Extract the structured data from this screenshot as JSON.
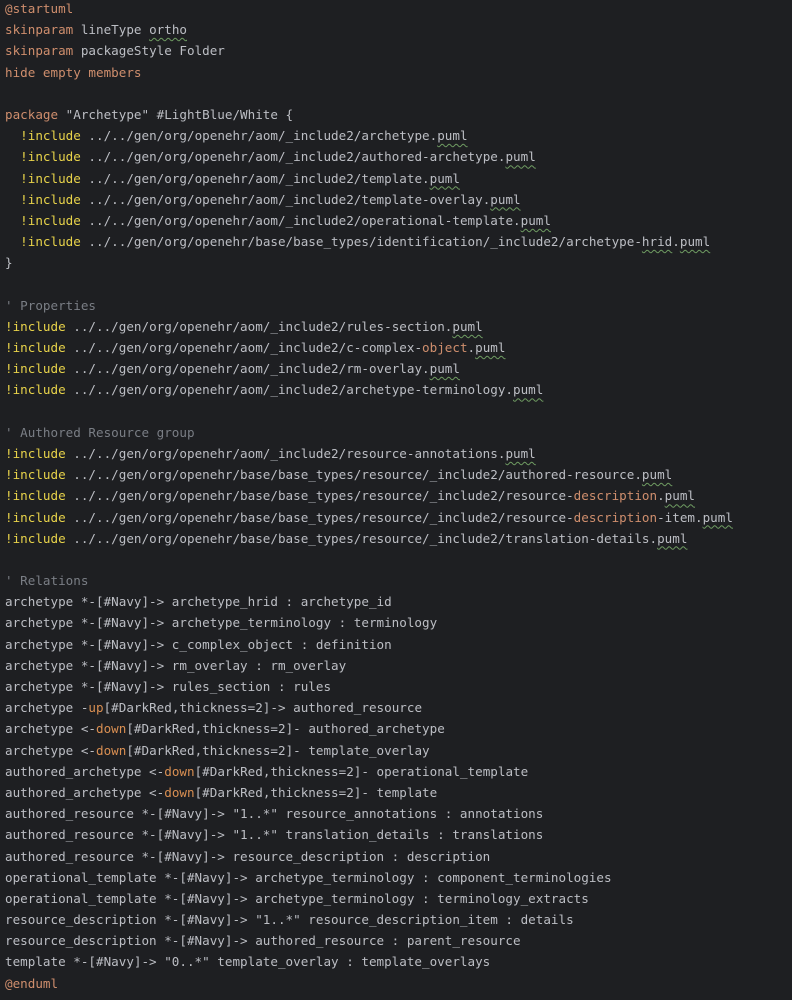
{
  "editor": {
    "language": "plantuml",
    "theme": {
      "background": "#1e1f22",
      "text": "#bcbec4",
      "keyword": "#cf8e6d",
      "include_directive": "#e8d34a",
      "comment": "#7a7e85",
      "direction": "#d98f52",
      "spellcheck_underline": "#6f9c62"
    },
    "lines": [
      [
        {
          "t": "@startuml",
          "c": "kw"
        }
      ],
      [
        {
          "t": "skinparam",
          "c": "kw"
        },
        {
          "t": " lineType ",
          "c": "text"
        },
        {
          "t": "ortho",
          "c": "text",
          "squig": true
        }
      ],
      [
        {
          "t": "skinparam",
          "c": "kw"
        },
        {
          "t": " packageStyle Folder",
          "c": "text"
        }
      ],
      [
        {
          "t": "hide empty members",
          "c": "kw"
        }
      ],
      [],
      [
        {
          "t": "package",
          "c": "kw"
        },
        {
          "t": " \"Archetype\" #LightBlue/White {",
          "c": "text"
        }
      ],
      [
        {
          "t": "  ",
          "c": "text"
        },
        {
          "t": "!include",
          "c": "inc"
        },
        {
          "t": " ../../gen/org/openehr/aom/_include2/archetype.",
          "c": "text"
        },
        {
          "t": "puml",
          "c": "text",
          "squig": true
        }
      ],
      [
        {
          "t": "  ",
          "c": "text"
        },
        {
          "t": "!include",
          "c": "inc"
        },
        {
          "t": " ../../gen/org/openehr/aom/_include2/authored-archetype.",
          "c": "text"
        },
        {
          "t": "puml",
          "c": "text",
          "squig": true
        }
      ],
      [
        {
          "t": "  ",
          "c": "text"
        },
        {
          "t": "!include",
          "c": "inc"
        },
        {
          "t": " ../../gen/org/openehr/aom/_include2/template.",
          "c": "text"
        },
        {
          "t": "puml",
          "c": "text",
          "squig": true
        }
      ],
      [
        {
          "t": "  ",
          "c": "text"
        },
        {
          "t": "!include",
          "c": "inc"
        },
        {
          "t": " ../../gen/org/openehr/aom/_include2/template-overlay.",
          "c": "text"
        },
        {
          "t": "puml",
          "c": "text",
          "squig": true
        }
      ],
      [
        {
          "t": "  ",
          "c": "text"
        },
        {
          "t": "!include",
          "c": "inc"
        },
        {
          "t": " ../../gen/org/openehr/aom/_include2/operational-template.",
          "c": "text"
        },
        {
          "t": "puml",
          "c": "text",
          "squig": true
        }
      ],
      [
        {
          "t": "  ",
          "c": "text"
        },
        {
          "t": "!include",
          "c": "inc"
        },
        {
          "t": " ../../gen/org/openehr/base/base_types/identification/_include2/archetype-",
          "c": "text"
        },
        {
          "t": "hrid",
          "c": "text",
          "squig": true
        },
        {
          "t": ".",
          "c": "text"
        },
        {
          "t": "puml",
          "c": "text",
          "squig": true
        }
      ],
      [
        {
          "t": "}",
          "c": "text"
        }
      ],
      [],
      [
        {
          "t": "' Properties",
          "c": "com"
        }
      ],
      [
        {
          "t": "!include",
          "c": "inc"
        },
        {
          "t": " ../../gen/org/openehr/aom/_include2/rules-section.",
          "c": "text"
        },
        {
          "t": "puml",
          "c": "text",
          "squig": true
        }
      ],
      [
        {
          "t": "!include",
          "c": "inc"
        },
        {
          "t": " ../../gen/org/openehr/aom/_include2/c-complex-",
          "c": "text"
        },
        {
          "t": "object",
          "c": "kw"
        },
        {
          "t": ".",
          "c": "text"
        },
        {
          "t": "puml",
          "c": "text",
          "squig": true
        }
      ],
      [
        {
          "t": "!include",
          "c": "inc"
        },
        {
          "t": " ../../gen/org/openehr/aom/_include2/rm-overlay.",
          "c": "text"
        },
        {
          "t": "puml",
          "c": "text",
          "squig": true
        }
      ],
      [
        {
          "t": "!include",
          "c": "inc"
        },
        {
          "t": " ../../gen/org/openehr/aom/_include2/archetype-terminology.",
          "c": "text"
        },
        {
          "t": "puml",
          "c": "text",
          "squig": true
        }
      ],
      [],
      [
        {
          "t": "' Authored Resource group",
          "c": "com"
        }
      ],
      [
        {
          "t": "!include",
          "c": "inc"
        },
        {
          "t": " ../../gen/org/openehr/aom/_include2/resource-annotations.",
          "c": "text"
        },
        {
          "t": "puml",
          "c": "text",
          "squig": true
        }
      ],
      [
        {
          "t": "!include",
          "c": "inc"
        },
        {
          "t": " ../../gen/org/openehr/base/base_types/resource/_include2/authored-resource.",
          "c": "text"
        },
        {
          "t": "puml",
          "c": "text",
          "squig": true
        }
      ],
      [
        {
          "t": "!include",
          "c": "inc"
        },
        {
          "t": " ../../gen/org/openehr/base/base_types/resource/_include2/resource-",
          "c": "text"
        },
        {
          "t": "description",
          "c": "kw"
        },
        {
          "t": ".",
          "c": "text"
        },
        {
          "t": "puml",
          "c": "text",
          "squig": true
        }
      ],
      [
        {
          "t": "!include",
          "c": "inc"
        },
        {
          "t": " ../../gen/org/openehr/base/base_types/resource/_include2/resource-",
          "c": "text"
        },
        {
          "t": "description",
          "c": "kw"
        },
        {
          "t": "-item.",
          "c": "text"
        },
        {
          "t": "puml",
          "c": "text",
          "squig": true
        }
      ],
      [
        {
          "t": "!include",
          "c": "inc"
        },
        {
          "t": " ../../gen/org/openehr/base/base_types/resource/_include2/translation-details.",
          "c": "text"
        },
        {
          "t": "puml",
          "c": "text",
          "squig": true
        }
      ],
      [],
      [
        {
          "t": "' Relations",
          "c": "com"
        }
      ],
      [
        {
          "t": "archetype *-[#Navy]-> archetype_hrid : archetype_id",
          "c": "text"
        }
      ],
      [
        {
          "t": "archetype *-[#Navy]-> archetype_terminology : terminology",
          "c": "text"
        }
      ],
      [
        {
          "t": "archetype *-[#Navy]-> c_complex_object : definition",
          "c": "text"
        }
      ],
      [
        {
          "t": "archetype *-[#Navy]-> rm_overlay : rm_overlay",
          "c": "text"
        }
      ],
      [
        {
          "t": "archetype *-[#Navy]-> rules_section : rules",
          "c": "text"
        }
      ],
      [
        {
          "t": "archetype -",
          "c": "text"
        },
        {
          "t": "up",
          "c": "dir"
        },
        {
          "t": "[#DarkRed,thickness=2]-> authored_resource",
          "c": "text"
        }
      ],
      [
        {
          "t": "archetype <-",
          "c": "text"
        },
        {
          "t": "down",
          "c": "dir"
        },
        {
          "t": "[#DarkRed,thickness=2]- authored_archetype",
          "c": "text"
        }
      ],
      [
        {
          "t": "archetype <-",
          "c": "text"
        },
        {
          "t": "down",
          "c": "dir"
        },
        {
          "t": "[#DarkRed,thickness=2]- template_overlay",
          "c": "text"
        }
      ],
      [
        {
          "t": "authored_archetype <-",
          "c": "text"
        },
        {
          "t": "down",
          "c": "dir"
        },
        {
          "t": "[#DarkRed,thickness=2]- operational_template",
          "c": "text"
        }
      ],
      [
        {
          "t": "authored_archetype <-",
          "c": "text"
        },
        {
          "t": "down",
          "c": "dir"
        },
        {
          "t": "[#DarkRed,thickness=2]- template",
          "c": "text"
        }
      ],
      [
        {
          "t": "authored_resource *-[#Navy]-> \"1..*\" resource_annotations : annotations",
          "c": "text"
        }
      ],
      [
        {
          "t": "authored_resource *-[#Navy]-> \"1..*\" translation_details : translations",
          "c": "text"
        }
      ],
      [
        {
          "t": "authored_resource *-[#Navy]-> resource_description : description",
          "c": "text"
        }
      ],
      [
        {
          "t": "operational_template *-[#Navy]-> archetype_terminology : component_terminologies",
          "c": "text"
        }
      ],
      [
        {
          "t": "operational_template *-[#Navy]-> archetype_terminology : terminology_extracts",
          "c": "text"
        }
      ],
      [
        {
          "t": "resource_description *-[#Navy]-> \"1..*\" resource_description_item : details",
          "c": "text"
        }
      ],
      [
        {
          "t": "resource_description *-[#Navy]-> authored_resource : parent_resource",
          "c": "text"
        }
      ],
      [
        {
          "t": "template *-[#Navy]-> \"0..*\" template_overlay : template_overlays",
          "c": "text"
        }
      ],
      [
        {
          "t": "@enduml",
          "c": "kw"
        }
      ]
    ]
  }
}
